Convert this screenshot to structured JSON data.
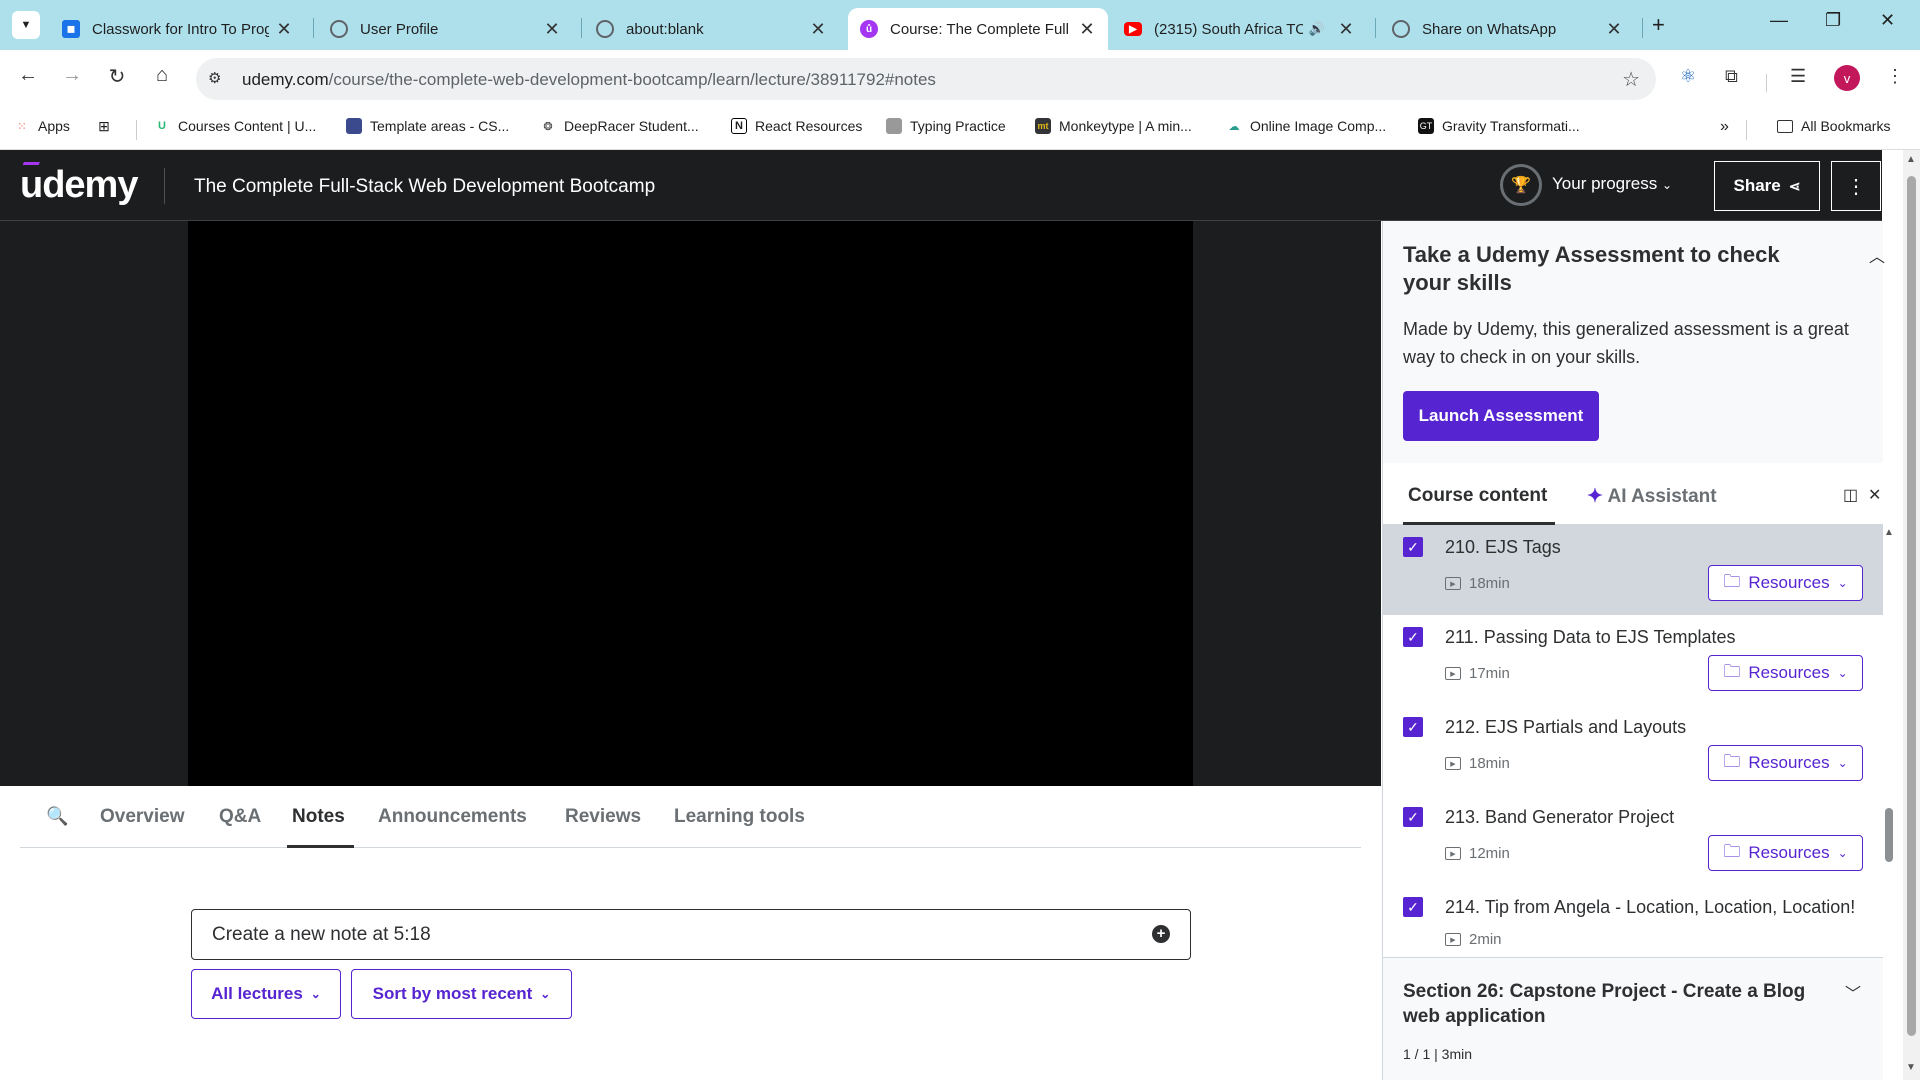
{
  "browser": {
    "tabs": [
      {
        "title": "Classwork for Intro To Prog",
        "favicon": "classroom-icon",
        "color": "#1a73e8"
      },
      {
        "title": "User Profile",
        "favicon": "globe-icon",
        "color": "#5f6368"
      },
      {
        "title": "about:blank",
        "favicon": "globe-icon",
        "color": "#5f6368"
      },
      {
        "title": "Course: The Complete Full",
        "favicon": "udemy-icon",
        "color": "#a435f0",
        "active": true
      },
      {
        "title": "(2315) South Africa TO",
        "favicon": "youtube-icon",
        "color": "#ff0000",
        "audio": true
      },
      {
        "title": "Share on WhatsApp",
        "favicon": "globe-icon",
        "color": "#5f6368"
      }
    ],
    "address": {
      "host": "udemy.com",
      "path": "/course/the-complete-web-development-bootcamp/learn/lecture/38911792#notes"
    },
    "profile_initial": "v",
    "bookmarks": [
      {
        "label": "Apps",
        "icon": "apps-grid-icon"
      },
      {
        "label": "Courses Content | U...",
        "icon": "courses-icon"
      },
      {
        "label": "Template areas - CS...",
        "icon": "template-icon"
      },
      {
        "label": "DeepRacer Student...",
        "icon": "deepracer-icon"
      },
      {
        "label": "React Resources",
        "icon": "notion-icon"
      },
      {
        "label": "Typing Practice",
        "icon": "typing-icon"
      },
      {
        "label": "Monkeytype | A min...",
        "icon": "monkeytype-icon"
      },
      {
        "label": "Online Image Comp...",
        "icon": "image-compress-icon"
      },
      {
        "label": "Gravity Transformati...",
        "icon": "gravity-icon"
      }
    ],
    "all_bookmarks": "All Bookmarks"
  },
  "header": {
    "logo": "udemy",
    "course_title": "The Complete Full-Stack Web Development Bootcamp",
    "progress_label": "Your progress",
    "share_label": "Share"
  },
  "lecture_tabs": {
    "items": [
      "Overview",
      "Q&A",
      "Notes",
      "Announcements",
      "Reviews",
      "Learning tools"
    ],
    "active": "Notes"
  },
  "notes": {
    "new_note_placeholder": "Create a new note at 5:18",
    "filter_lectures": "All lectures",
    "sort": "Sort by most recent"
  },
  "sidebar": {
    "assessment": {
      "title": "Take a Udemy Assessment to check your skills",
      "description": "Made by Udemy, this generalized assessment is a great way to check in on your skills.",
      "button": "Launch Assessment"
    },
    "tabs": {
      "course_content": "Course content",
      "ai_assistant": "AI Assistant"
    },
    "lectures": [
      {
        "title": "210. EJS Tags",
        "duration": "18min",
        "resources": "Resources",
        "current": true
      },
      {
        "title": "211. Passing Data to EJS Templates",
        "duration": "17min",
        "resources": "Resources"
      },
      {
        "title": "212. EJS Partials and Layouts",
        "duration": "18min",
        "resources": "Resources"
      },
      {
        "title": "213. Band Generator Project",
        "duration": "12min",
        "resources": "Resources"
      },
      {
        "title": "214. Tip from Angela - Location, Location, Location!",
        "duration": "2min"
      }
    ],
    "next_section": {
      "title": "Section 26: Capstone Project - Create a Blog web application",
      "meta": "1 / 1 | 3min"
    }
  },
  "colors": {
    "udemy_purple": "#5624d0",
    "header_dark": "#1c1d1f",
    "tabstrip": "#aee0ec"
  }
}
